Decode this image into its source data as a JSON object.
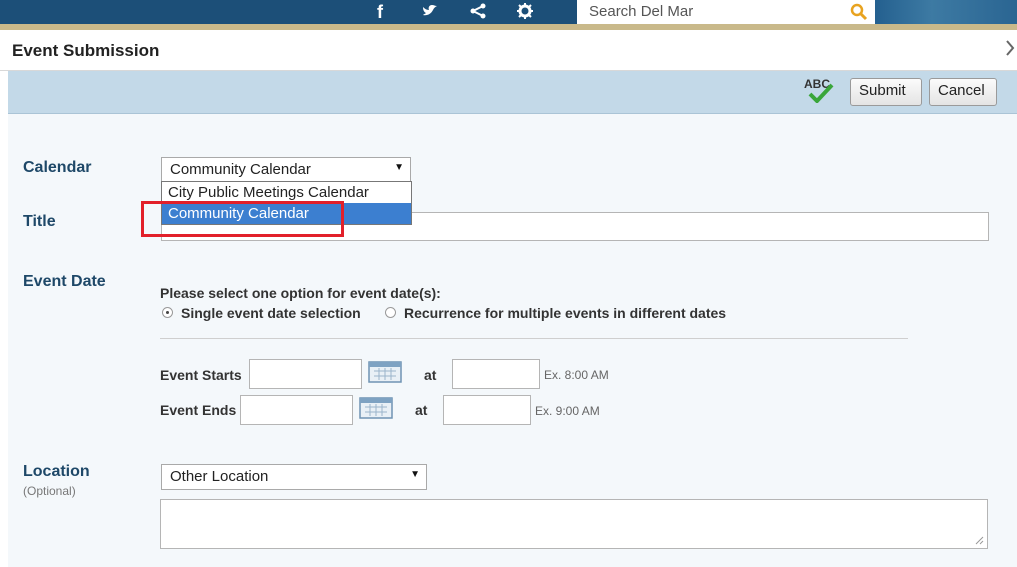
{
  "site": {
    "search_placeholder": "Search Del Mar",
    "social_icons": [
      "facebook-icon",
      "twitter-icon",
      "share-icon",
      "gear-icon"
    ]
  },
  "dialog": {
    "title": "Event Submission",
    "close_icon": "chevron-right-icon"
  },
  "toolbar": {
    "spellcheck_label": "ABC",
    "submit_label": "Submit",
    "cancel_label": "Cancel"
  },
  "form": {
    "calendar": {
      "label": "Calendar",
      "selected": "Community Calendar",
      "options": [
        "City Public Meetings Calendar",
        "Community Calendar"
      ],
      "highlighted_option": "Community Calendar"
    },
    "title": {
      "label": "Title",
      "value": ""
    },
    "event_date": {
      "label": "Event Date",
      "prompt": "Please select one option for event date(s):",
      "option_single": "Single event date selection",
      "option_recurrence": "Recurrence for multiple events in different dates",
      "selected": "single",
      "starts_label": "Event Starts",
      "ends_label": "Event Ends",
      "at_label": "at",
      "start_example": "Ex. 8:00 AM",
      "end_example": "Ex. 9:00 AM"
    },
    "location": {
      "label": "Location",
      "sublabel": "(Optional)",
      "selected": "Other Location"
    }
  },
  "colors": {
    "accent_blue": "#1e4868",
    "selection": "#3c7fd0",
    "highlight_box": "#e2202a"
  }
}
